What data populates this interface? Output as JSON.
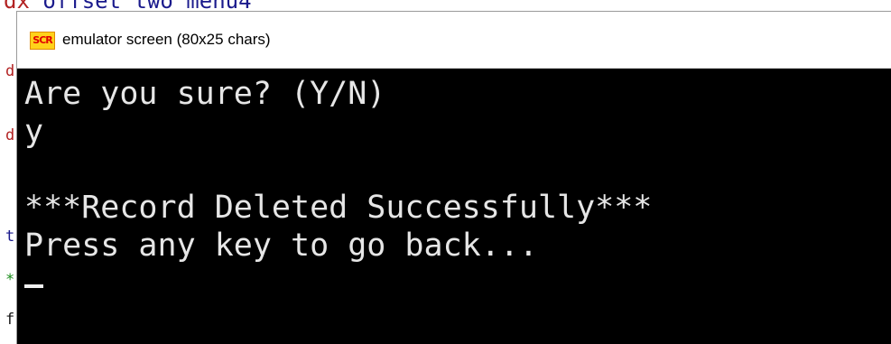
{
  "background_editor": {
    "top_line_part1": "dx",
    "top_line_part2": " offset two menu4",
    "gutter_chars": [
      "d",
      "d",
      "t",
      "*",
      "f"
    ]
  },
  "window": {
    "icon_label": "SCR",
    "title": "emulator screen (80x25 chars)"
  },
  "console": {
    "lines": [
      "Are you sure? (Y/N)",
      "y",
      "",
      "***Record Deleted Successfully***",
      "Press any key to go back..."
    ],
    "text_color": "#e6e6e6",
    "background_color": "#000000"
  },
  "colors": {
    "icon_background": "#ffd21a",
    "icon_text": "#e00000",
    "title_bar": "#ffffff"
  }
}
